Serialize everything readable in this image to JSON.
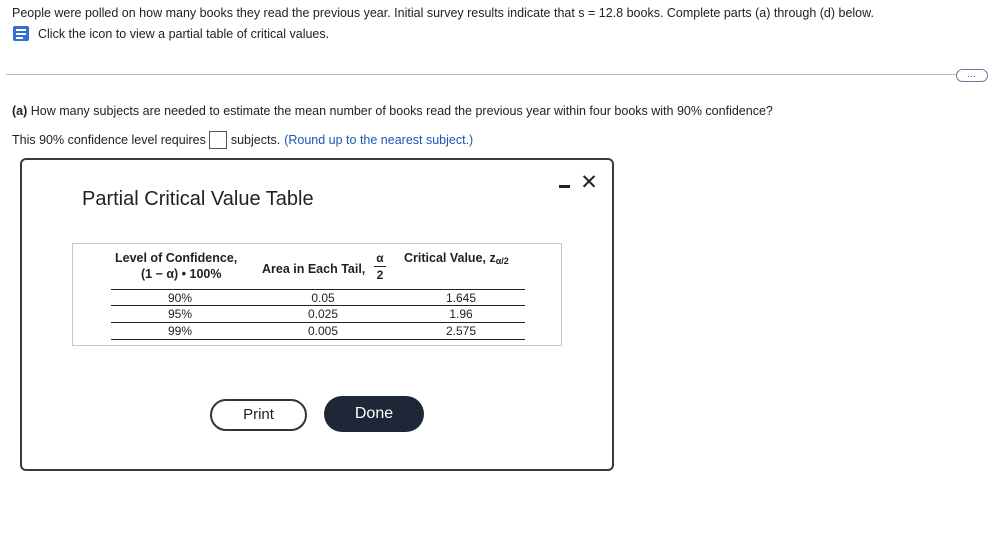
{
  "intro": {
    "text": "People were polled on how many books they read the previous year. Initial survey results indicate that s = 12.8 books. Complete parts (a) through (d) below.",
    "link_text": "Click the icon to view a partial table of critical values."
  },
  "icons": {
    "document": "document-icon",
    "more": "more-options-icon",
    "minimize": "minimize-icon",
    "close": "close-icon"
  },
  "more_button": "…",
  "part_a": {
    "label": "(a)",
    "question": "How many subjects are needed to estimate the mean number of books read the previous year within four books with 90% confidence?",
    "answer_prefix": "This 90% confidence level requires",
    "answer_value": "",
    "answer_suffix": "subjects.",
    "hint": "(Round up to the nearest subject.)"
  },
  "modal": {
    "title": "Partial Critical Value Table",
    "close_glyph": "✕",
    "headers": {
      "level_line1": "Level of Confidence,",
      "level_line2": "(1 − α) • 100%",
      "area": "Area in Each Tail,",
      "alpha": "α",
      "two": "2",
      "critical": "Critical Value, z",
      "critical_sub": "α/2"
    },
    "rows": [
      {
        "level": "90%",
        "area": "0.05",
        "critical": "1.645"
      },
      {
        "level": "95%",
        "area": "0.025",
        "critical": "1.96"
      },
      {
        "level": "99%",
        "area": "0.005",
        "critical": "2.575"
      }
    ],
    "print_label": "Print",
    "done_label": "Done"
  },
  "colors": {
    "link": "#1a56b8",
    "done_button": "#1e2738",
    "icon_blue": "#2f6fd6"
  }
}
